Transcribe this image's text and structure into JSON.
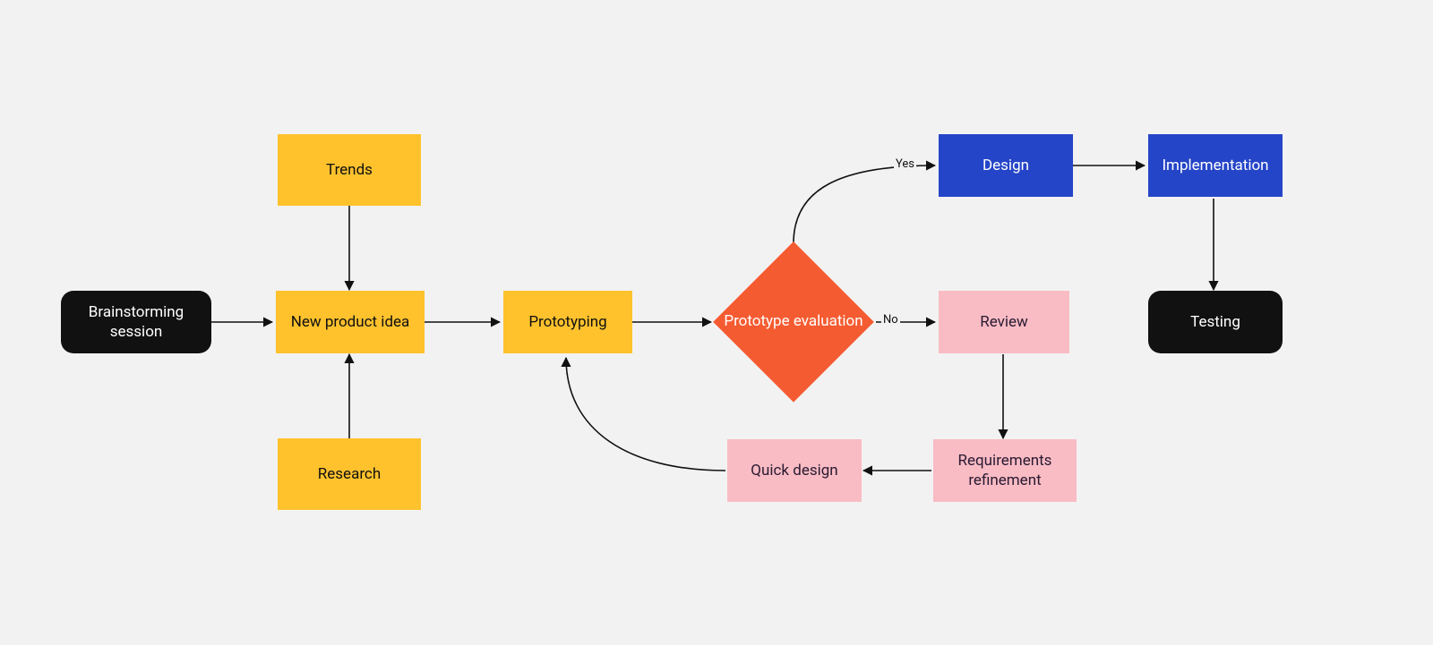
{
  "nodes": {
    "brainstorming": {
      "label": "Brainstorming session"
    },
    "trends": {
      "label": "Trends"
    },
    "research": {
      "label": "Research"
    },
    "newIdea": {
      "label": "New product idea"
    },
    "prototyping": {
      "label": "Prototyping"
    },
    "protoEval": {
      "label": "Prototype evaluation"
    },
    "review": {
      "label": "Review"
    },
    "reqRefine": {
      "label": "Requirements refinement"
    },
    "quickDesign": {
      "label": "Quick design"
    },
    "design": {
      "label": "Design"
    },
    "implementation": {
      "label": "Implementation"
    },
    "testing": {
      "label": "Testing"
    }
  },
  "edgeLabels": {
    "yes": "Yes",
    "no": "No"
  },
  "colors": {
    "black": "#111111",
    "yellow": "#ffc22d",
    "blue": "#2545c8",
    "pink": "#f9bcc4",
    "orange": "#f55b31",
    "bg": "#f2f2f2"
  }
}
